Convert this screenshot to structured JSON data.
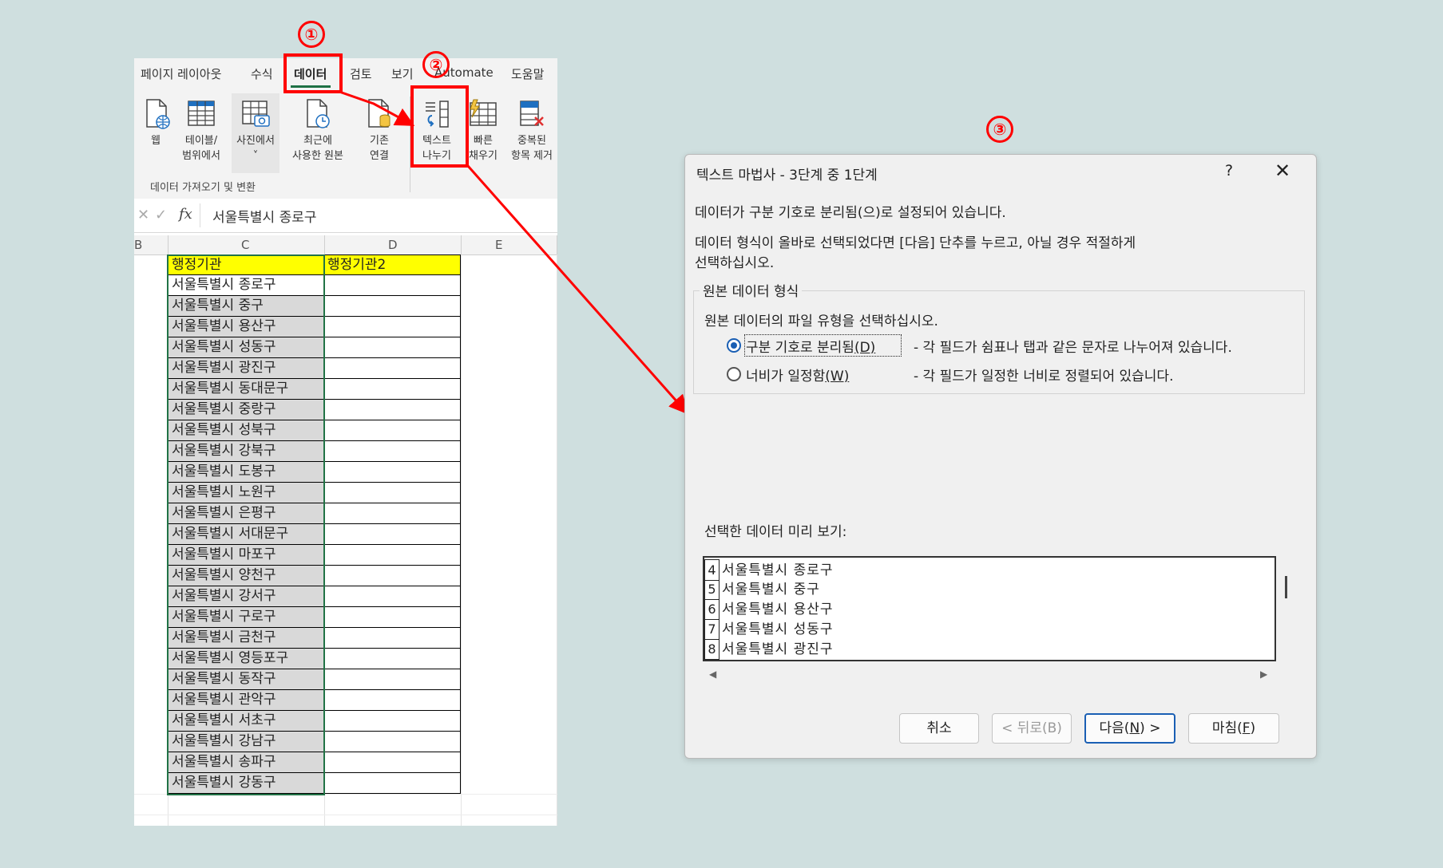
{
  "excel": {
    "ribbon_tabs": [
      "페이지 레이아웃",
      "수식",
      "데이터",
      "검토",
      "보기",
      "Automate",
      "도움말"
    ],
    "active_tab": "데이터",
    "ribbon_buttons": {
      "web": "웹",
      "from_table": "테이블/\n범위에서",
      "from_picture": "사진에서\n˅",
      "recent_sources": "최근에\n사용한 원본",
      "existing_connections": "기존\n연결",
      "text_to_columns": "텍스트\n나누기",
      "flash_fill": "빠른\n채우기",
      "remove_duplicates": "중복된\n항목 제거"
    },
    "group_label": "데이터 가져오기 및 변환",
    "formula_bar": {
      "cancel": "✕",
      "enter": "✓",
      "fx": "fx",
      "value": "서울특별시 종로구"
    },
    "column_headers": [
      "B",
      "C",
      "D",
      "E"
    ],
    "header_row": [
      "행정기관",
      "행정기관2"
    ],
    "rows": [
      "서울특별시 종로구",
      "서울특별시 중구",
      "서울특별시 용산구",
      "서울특별시 성동구",
      "서울특별시 광진구",
      "서울특별시 동대문구",
      "서울특별시 중랑구",
      "서울특별시 성북구",
      "서울특별시 강북구",
      "서울특별시 도봉구",
      "서울특별시 노원구",
      "서울특별시 은평구",
      "서울특별시 서대문구",
      "서울특별시 마포구",
      "서울특별시 양천구",
      "서울특별시 강서구",
      "서울특별시 구로구",
      "서울특별시 금천구",
      "서울특별시 영등포구",
      "서울특별시 동작구",
      "서울특별시 관악구",
      "서울특별시 서초구",
      "서울특별시 강남구",
      "서울특별시 송파구",
      "서울특별시 강동구"
    ]
  },
  "annotations": {
    "step1": "①",
    "step2": "②",
    "step3": "③",
    "color": "#ff0000"
  },
  "dialog": {
    "title": "텍스트 마법사 - 3단계 중 1단계",
    "help": "?",
    "close": "✕",
    "line1": "데이터가 구분 기호로 분리됨(으)로 설정되어 있습니다.",
    "line2": "데이터 형식이 올바로 선택되었다면 [다음] 단추를 누르고, 아닐 경우 적절하게",
    "line3": "선택하십시오.",
    "group_title": "원본 데이터 형식",
    "group_prompt": "원본 데이터의 파일 유형을 선택하십시오.",
    "option_delimited": {
      "label": "구분 기호로 분리됨",
      "key": "(D)",
      "desc": "- 각 필드가 쉼표나 탭과 같은 문자로 나누어져 있습니다.",
      "selected": true
    },
    "option_fixed": {
      "label": "너비가 일정함",
      "key": "(W)",
      "desc": "- 각 필드가 일정한 너비로 정렬되어 있습니다.",
      "selected": false
    },
    "preview_label": "선택한 데이터 미리 보기:",
    "preview_rows": [
      {
        "num": "4",
        "text": "서울특별시 종로구"
      },
      {
        "num": "5",
        "text": "서울특별시 중구"
      },
      {
        "num": "6",
        "text": "서울특별시 용산구"
      },
      {
        "num": "7",
        "text": "서울특별시 성동구"
      },
      {
        "num": "8",
        "text": "서울특별시 광진구"
      }
    ],
    "buttons": {
      "cancel": "취소",
      "back": "< 뒤로(B)",
      "next_pre": "다음(",
      "next_key": "N",
      "next_post": ") >",
      "finish_pre": "마침(",
      "finish_key": "F",
      "finish_post": ")"
    },
    "accent": "#1a5fb4"
  }
}
